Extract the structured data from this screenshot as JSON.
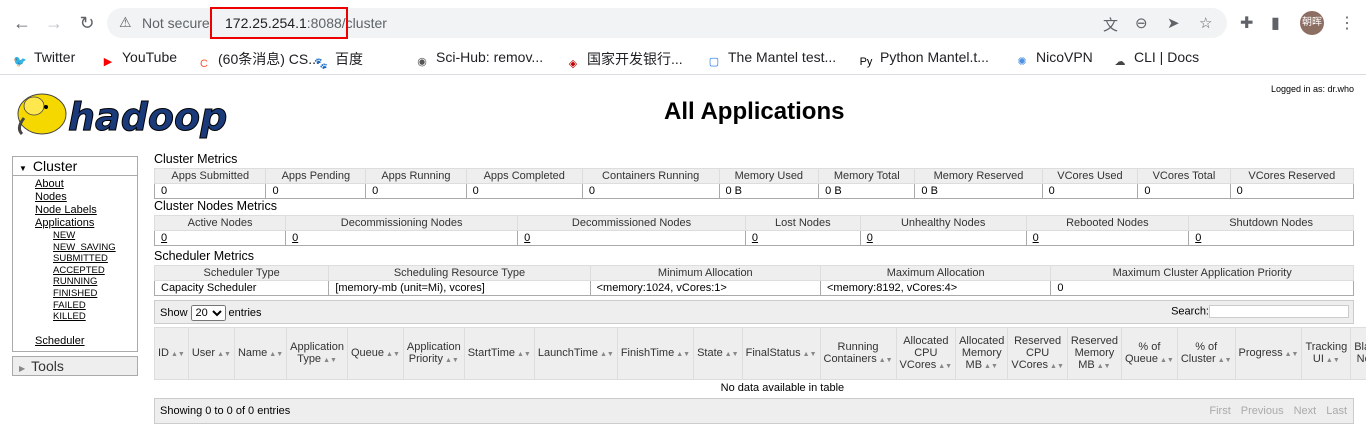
{
  "browser": {
    "security_label": "Not secure",
    "url_host": "172.25.254.1",
    "url_rest": ":8088/cluster",
    "avatar_text": "朝晖"
  },
  "bookmarks": [
    {
      "label": "Twitter",
      "icon": "twitter-icon",
      "color": "#1da1f2",
      "glyph": "🐦"
    },
    {
      "label": "YouTube",
      "icon": "youtube-icon",
      "color": "#ff0000",
      "glyph": "▶"
    },
    {
      "label": "(60条消息) CS...",
      "icon": "csdn-icon",
      "color": "#fc5531",
      "glyph": "C"
    },
    {
      "label": "百度",
      "icon": "baidu-icon",
      "color": "#2932e1",
      "glyph": "🐾"
    },
    {
      "label": "Sci-Hub: remov...",
      "icon": "scihub-icon",
      "color": "#555555",
      "glyph": "◉"
    },
    {
      "label": "国家开发银行...",
      "icon": "cdb-icon",
      "color": "#c00000",
      "glyph": "◈"
    },
    {
      "label": "The Mantel test...",
      "icon": "page-icon",
      "color": "#1a73e8",
      "glyph": "▢"
    },
    {
      "label": "Python Mantel.t...",
      "icon": "py-icon",
      "color": "#000000",
      "glyph": "Py"
    },
    {
      "label": "NicoVPN",
      "icon": "nicovpn-icon",
      "color": "#4a90e2",
      "glyph": "✺"
    },
    {
      "label": "CLI | Docs",
      "icon": "cloud-icon",
      "color": "#444444",
      "glyph": "☁"
    }
  ],
  "page": {
    "logged_in": "Logged in as: dr.who",
    "title": "All Applications"
  },
  "sidebar": {
    "cluster_label": "Cluster",
    "items": [
      "About",
      "Nodes",
      "Node Labels",
      "Applications"
    ],
    "app_states": [
      "NEW",
      "NEW_SAVING",
      "SUBMITTED",
      "ACCEPTED",
      "RUNNING",
      "FINISHED",
      "FAILED",
      "KILLED"
    ],
    "scheduler": "Scheduler",
    "tools_label": "Tools"
  },
  "cluster_metrics": {
    "title": "Cluster Metrics",
    "headers": [
      "Apps Submitted",
      "Apps Pending",
      "Apps Running",
      "Apps Completed",
      "Containers Running",
      "Memory Used",
      "Memory Total",
      "Memory Reserved",
      "VCores Used",
      "VCores Total",
      "VCores Reserved"
    ],
    "values": [
      "0",
      "0",
      "0",
      "0",
      "0",
      "0 B",
      "0 B",
      "0 B",
      "0",
      "0",
      "0"
    ]
  },
  "node_metrics": {
    "title": "Cluster Nodes Metrics",
    "headers": [
      "Active Nodes",
      "Decommissioning Nodes",
      "Decommissioned Nodes",
      "Lost Nodes",
      "Unhealthy Nodes",
      "Rebooted Nodes",
      "Shutdown Nodes"
    ],
    "values": [
      "0",
      "0",
      "0",
      "0",
      "0",
      "0",
      "0"
    ]
  },
  "scheduler_metrics": {
    "title": "Scheduler Metrics",
    "headers": [
      "Scheduler Type",
      "Scheduling Resource Type",
      "Minimum Allocation",
      "Maximum Allocation",
      "Maximum Cluster Application Priority"
    ],
    "values": [
      "Capacity Scheduler",
      "[memory-mb (unit=Mi), vcores]",
      "<memory:1024, vCores:1>",
      "<memory:8192, vCores:4>",
      "0"
    ]
  },
  "apps_table": {
    "show_label": "Show",
    "entries_value": "20",
    "entries_label": "entries",
    "search_label": "Search:",
    "headers": [
      "ID",
      "User",
      "Name",
      "Application Type",
      "Queue",
      "Application Priority",
      "StartTime",
      "LaunchTime",
      "FinishTime",
      "State",
      "FinalStatus",
      "Running Containers",
      "Allocated CPU VCores",
      "Allocated Memory MB",
      "Reserved CPU VCores",
      "Reserved Memory MB",
      "% of Queue",
      "% of Cluster",
      "Progress",
      "Tracking UI",
      "Blacklisted Nodes"
    ],
    "empty_text": "No data available in table",
    "info_text": "Showing 0 to 0 of 0 entries",
    "pager": [
      "First",
      "Previous",
      "Next",
      "Last"
    ]
  }
}
